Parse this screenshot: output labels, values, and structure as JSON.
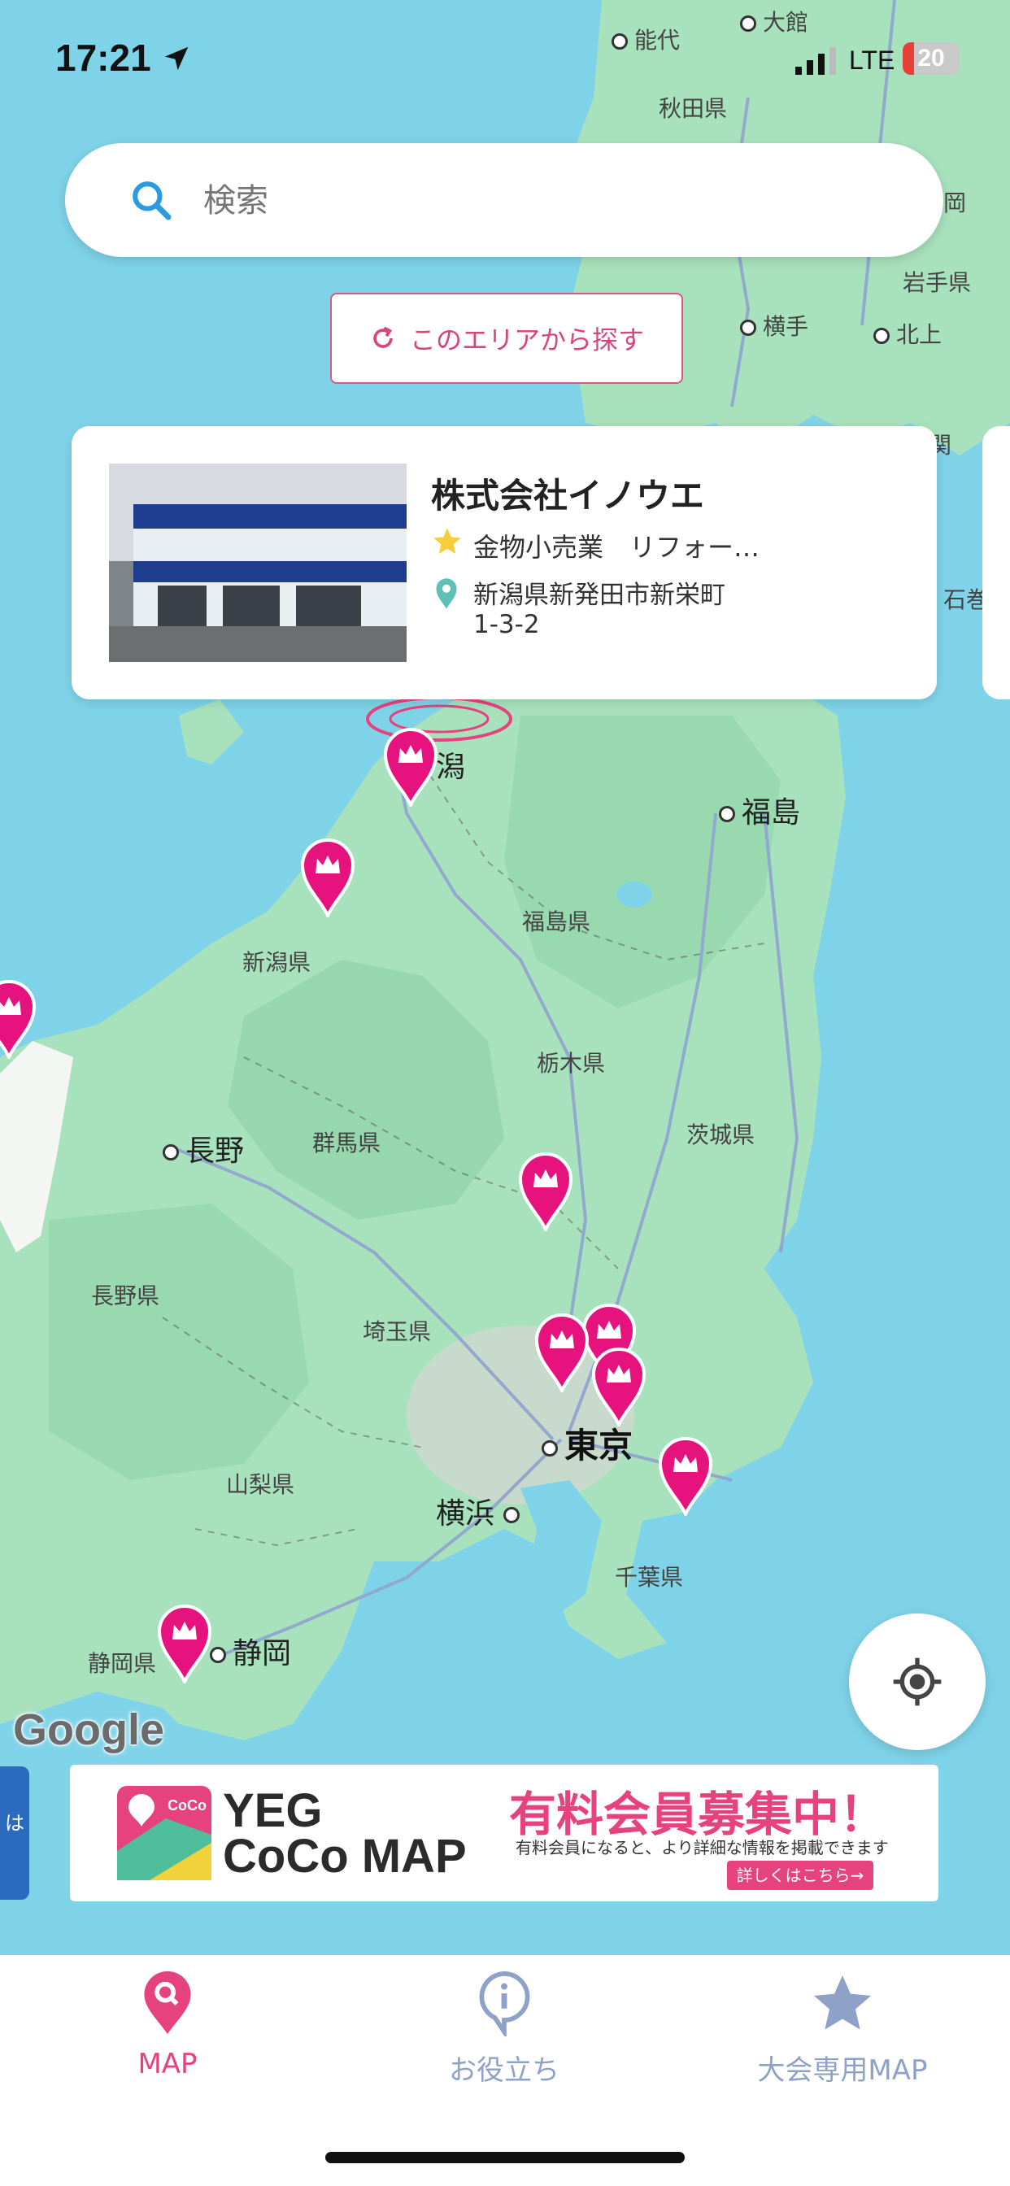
{
  "status_bar": {
    "time": "17:21",
    "network": "LTE",
    "battery": "20",
    "battery_level": 0.2
  },
  "search": {
    "placeholder": "検索"
  },
  "area_search": {
    "label": "このエリアから探す"
  },
  "card": {
    "name": "株式会社イノウエ",
    "category": "金物小売業　リフォー…",
    "address_line1": "新潟県新発田市新栄町",
    "address_line2": "1-3-2"
  },
  "map": {
    "labels": {
      "noshiro": "能代",
      "odate": "大館",
      "akita_pref": "秋田県",
      "kita": "岡",
      "iwate_pref": "岩手県",
      "yokote": "横手",
      "kitakami": "北上",
      "seki": "関",
      "ishi": "石巻",
      "fukushima": "福島",
      "fukushima_pref": "福島県",
      "niigata_city": "潟",
      "niigata_pref": "新潟県",
      "nagano": "長野",
      "gunma_pref": "群馬県",
      "tochigi_pref": "栃木県",
      "ibaraki_pref": "茨城県",
      "nagano_pref": "長野県",
      "saitama_pref": "埼玉県",
      "tokyo": "東京",
      "yamanashi_pref": "山梨県",
      "yokohama": "横浜",
      "chiba_pref": "千葉県",
      "shizuoka_pref": "静岡県",
      "shizuoka": "静岡"
    },
    "attribution": "Google"
  },
  "banner": {
    "logo_text": "CoCo MAP",
    "title_line1": "YEG",
    "title_line2": "CoCo MAP",
    "headline": "有料会員募集中！",
    "subtext": "有料会員になると、より詳細な情報を掲載できます",
    "cta": "詳しくはこちら→"
  },
  "side_tab": {
    "label": "は"
  },
  "tabbar": {
    "items": [
      {
        "label": "MAP",
        "active": true
      },
      {
        "label": "お役立ち",
        "active": false
      },
      {
        "label": "大会専用MAP",
        "active": false
      }
    ]
  },
  "colors": {
    "accent": "#e6427e",
    "inactive": "#8ea2c8",
    "water": "#7fd3e8",
    "land": "#a8e2bd"
  }
}
